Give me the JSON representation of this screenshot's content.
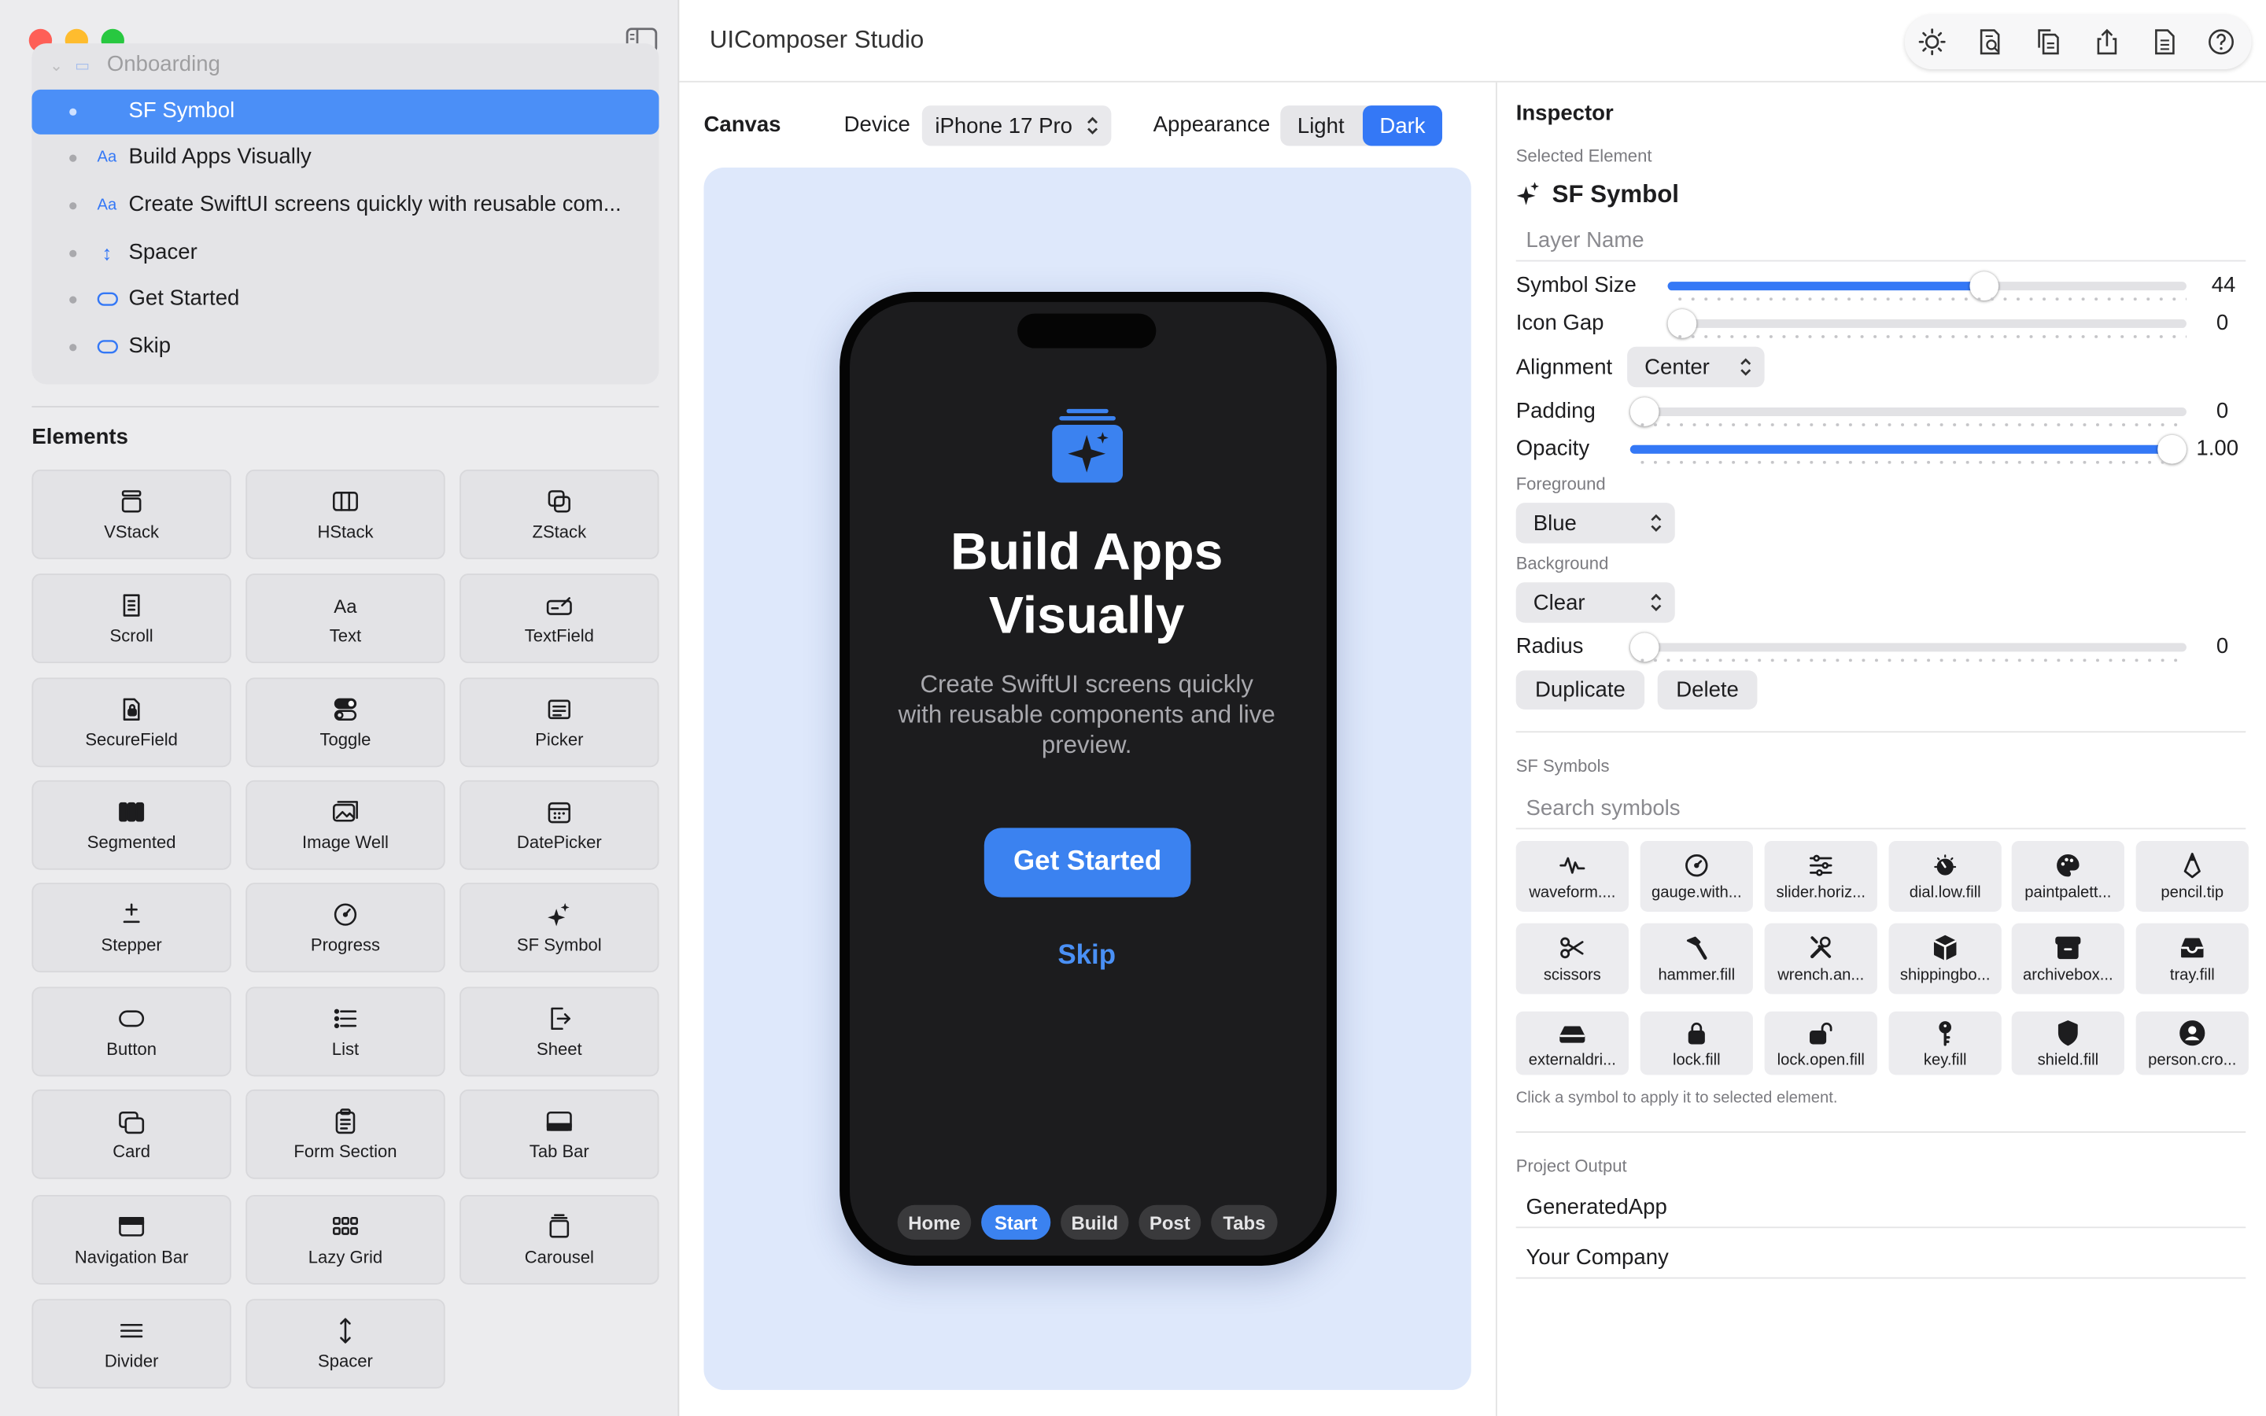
{
  "window": {
    "title": "UIComposer Studio",
    "traffic": {
      "close": "#fe5f57",
      "minimize": "#febc2e",
      "zoom": "#28c840"
    }
  },
  "toolbar": {
    "icons": [
      "sun-icon",
      "doc-search-icon",
      "duplicate-doc-icon",
      "share-icon",
      "document-icon",
      "help-icon"
    ]
  },
  "layers": {
    "group": "Onboarding",
    "items": [
      {
        "label": "SF Symbol",
        "icon": "sparkle-icon",
        "selected": true
      },
      {
        "label": "Build Apps Visually",
        "icon": "text-icon"
      },
      {
        "label": "Create SwiftUI screens quickly with reusable com...",
        "icon": "text-icon"
      },
      {
        "label": "Spacer",
        "icon": "vertical-arrows-icon"
      },
      {
        "label": "Get Started",
        "icon": "capsule-icon"
      },
      {
        "label": "Skip",
        "icon": "capsule-icon"
      }
    ]
  },
  "elements": {
    "title": "Elements",
    "items": [
      "VStack",
      "HStack",
      "ZStack",
      "Scroll",
      "Text",
      "TextField",
      "SecureField",
      "Toggle",
      "Picker",
      "Segmented",
      "Image Well",
      "DatePicker",
      "Stepper",
      "Progress",
      "SF Symbol",
      "Button",
      "List",
      "Sheet",
      "Card",
      "Form Section",
      "Tab Bar",
      "Navigation Bar",
      "Lazy Grid",
      "Carousel",
      "Divider",
      "Spacer"
    ]
  },
  "canvas": {
    "label": "Canvas",
    "device_label": "Device",
    "device": "iPhone 17 Pro",
    "appearance_label": "Appearance",
    "appearance_options": [
      "Light",
      "Dark"
    ],
    "appearance_selected": "Dark",
    "bg": "#dee8fb"
  },
  "phone": {
    "title": "Build Apps Visually",
    "subtitle": "Create SwiftUI screens quickly with reusable components and live preview.",
    "cta": "Get Started",
    "secondary": "Skip",
    "tabs": [
      "Home",
      "Start",
      "Build",
      "Post",
      "Tabs"
    ],
    "active_tab": "Start",
    "accent": "#3b82f0"
  },
  "inspector": {
    "title": "Inspector",
    "selected_label": "Selected Element",
    "selected_name": "SF Symbol",
    "layer_name_placeholder": "Layer Name",
    "symbol_size": {
      "label": "Symbol Size",
      "value": "44",
      "fraction": 0.61
    },
    "icon_gap": {
      "label": "Icon Gap",
      "value": "0",
      "fraction": 0
    },
    "alignment": {
      "label": "Alignment",
      "value": "Center"
    },
    "padding": {
      "label": "Padding",
      "value": "0",
      "fraction": 0
    },
    "opacity": {
      "label": "Opacity",
      "value": "1.00",
      "fraction": 1
    },
    "foreground": {
      "label": "Foreground",
      "value": "Blue"
    },
    "background": {
      "label": "Background",
      "value": "Clear"
    },
    "radius": {
      "label": "Radius",
      "value": "0",
      "fraction": 0
    },
    "duplicate": "Duplicate",
    "delete": "Delete"
  },
  "symbols": {
    "title": "SF Symbols",
    "search_placeholder": "Search symbols",
    "items": [
      "waveform....",
      "gauge.with...",
      "slider.horiz...",
      "dial.low.fill",
      "paintpalett...",
      "pencil.tip",
      "scissors",
      "hammer.fill",
      "wrench.an...",
      "shippingbo...",
      "archivebox...",
      "tray.fill",
      "externaldri...",
      "lock.fill",
      "lock.open.fill",
      "key.fill",
      "shield.fill",
      "person.cro..."
    ],
    "hint": "Click a symbol to apply it to selected element."
  },
  "output": {
    "title": "Project Output",
    "app_name": "GeneratedApp",
    "company": "Your Company"
  }
}
